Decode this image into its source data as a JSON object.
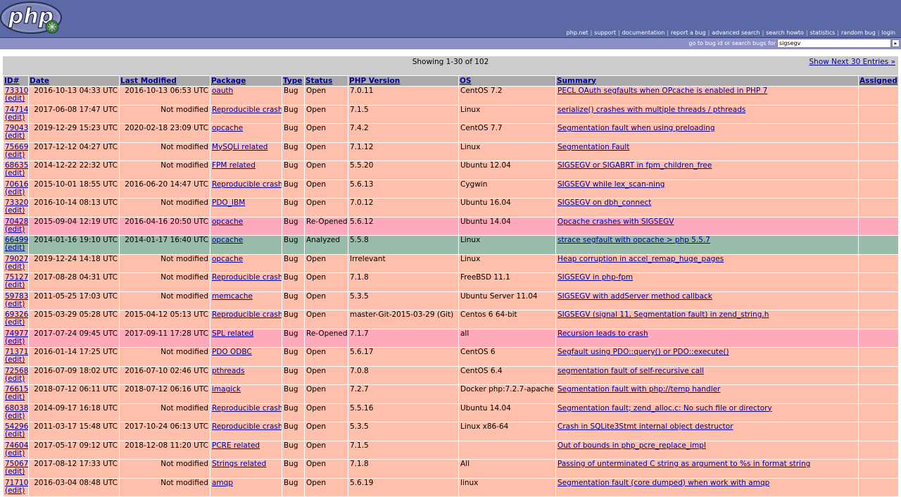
{
  "header": {
    "logo_text": "php",
    "links": [
      "php.net",
      "support",
      "documentation",
      "report a bug",
      "advanced search",
      "search howto",
      "statistics",
      "random bug",
      "login"
    ]
  },
  "search": {
    "label": "go to bug id or search bugs for",
    "value": "sigsegv",
    "go_label": "▸"
  },
  "results": {
    "showing": "Showing 1-30 of 102",
    "next": "Show Next 30 Entries »"
  },
  "table": {
    "columns": [
      "ID#",
      "Date",
      "Last Modified",
      "Package",
      "Type",
      "Status",
      "PHP Version",
      "OS",
      "Summary",
      "Assigned"
    ],
    "edit_label": "(edit)",
    "rows": [
      {
        "id": "73310",
        "date": "2016-10-13 04:33 UTC",
        "mod": "2016-10-13 06:53 UTC",
        "pkg": "oauth",
        "type": "Bug",
        "status": "Open",
        "ver": "7.0.11",
        "os": "CentOS 7.2",
        "summary": "PECL OAuth segfaults when OPcache is enabled in PHP 7",
        "assigned": "",
        "cls": "open"
      },
      {
        "id": "74714",
        "date": "2017-06-08 17:47 UTC",
        "mod": "Not modified",
        "pkg": "Reproducible crash",
        "type": "Bug",
        "status": "Open",
        "ver": "7.1.5",
        "os": "Linux",
        "summary": "serialize() crashes with multiple threads / pthreads",
        "assigned": "",
        "cls": "open"
      },
      {
        "id": "79043",
        "date": "2019-12-29 15:23 UTC",
        "mod": "2020-02-18 23:09 UTC",
        "pkg": "opcache",
        "type": "Bug",
        "status": "Open",
        "ver": "7.4.2",
        "os": "CentOS 7.7",
        "summary": "Segmentation fault when using preloading",
        "assigned": "",
        "cls": "open"
      },
      {
        "id": "75669",
        "date": "2017-12-12 04:27 UTC",
        "mod": "Not modified",
        "pkg": "MySQLi related",
        "type": "Bug",
        "status": "Open",
        "ver": "7.1.12",
        "os": "Linux",
        "summary": "Segmentation Fault",
        "assigned": "",
        "cls": "open"
      },
      {
        "id": "68635",
        "date": "2014-12-22 22:32 UTC",
        "mod": "Not modified",
        "pkg": "FPM related",
        "type": "Bug",
        "status": "Open",
        "ver": "5.5.20",
        "os": "Ubuntu 12.04",
        "summary": "SIGSEGV or SIGABRT in fpm_children_free",
        "assigned": "",
        "cls": "open"
      },
      {
        "id": "70616",
        "date": "2015-10-01 18:55 UTC",
        "mod": "2016-06-20 14:47 UTC",
        "pkg": "Reproducible crash",
        "type": "Bug",
        "status": "Open",
        "ver": "5.6.13",
        "os": "Cygwin",
        "summary": "SIGSEGV while lex_scan-ning",
        "assigned": "",
        "cls": "open"
      },
      {
        "id": "73320",
        "date": "2016-10-14 08:13 UTC",
        "mod": "Not modified",
        "pkg": "PDO_IBM",
        "type": "Bug",
        "status": "Open",
        "ver": "7.0.12",
        "os": "Ubuntu 16.04",
        "summary": "SIGSEGV on dbh_connect",
        "assigned": "",
        "cls": "open"
      },
      {
        "id": "70428",
        "date": "2015-09-04 12:19 UTC",
        "mod": "2016-04-16 20:50 UTC",
        "pkg": "opcache",
        "type": "Bug",
        "status": "Re-Opened",
        "ver": "5.6.12",
        "os": "Ubuntu 14.04",
        "summary": "Opcache crashes with SIGSEGV",
        "assigned": "",
        "cls": "reopened"
      },
      {
        "id": "66499",
        "date": "2014-01-16 19:10 UTC",
        "mod": "2014-01-17 16:40 UTC",
        "pkg": "opcache",
        "type": "Bug",
        "status": "Analyzed",
        "ver": "5.5.8",
        "os": "Linux",
        "summary": "strace segfault with opcache > php 5.5.7",
        "assigned": "",
        "cls": "analyzed"
      },
      {
        "id": "79027",
        "date": "2019-12-24 14:18 UTC",
        "mod": "Not modified",
        "pkg": "opcache",
        "type": "Bug",
        "status": "Open",
        "ver": "Irrelevant",
        "os": "Linux",
        "summary": "Heap corruption in accel_remap_huge_pages",
        "assigned": "",
        "cls": "open"
      },
      {
        "id": "75127",
        "date": "2017-08-28 04:31 UTC",
        "mod": "Not modified",
        "pkg": "Reproducible crash",
        "type": "Bug",
        "status": "Open",
        "ver": "7.1.8",
        "os": "FreeBSD 11.1",
        "summary": "SIGSEGV in php-fpm",
        "assigned": "",
        "cls": "open"
      },
      {
        "id": "59783",
        "date": "2011-05-25 17:03 UTC",
        "mod": "Not modified",
        "pkg": "memcache",
        "type": "Bug",
        "status": "Open",
        "ver": "5.3.5",
        "os": "Ubuntu Server 11.04",
        "summary": "SIGSEGV with addServer method callback",
        "assigned": "",
        "cls": "open"
      },
      {
        "id": "69326",
        "date": "2015-03-29 05:28 UTC",
        "mod": "2015-04-12 05:13 UTC",
        "pkg": "Reproducible crash",
        "type": "Bug",
        "status": "Open",
        "ver": "master-Git-2015-03-29 (Git)",
        "os": "Centos 6 64-bit",
        "summary": "SIGSEGV (signal 11, Segmentation fault) in zend_string.h",
        "assigned": "",
        "cls": "open"
      },
      {
        "id": "74977",
        "date": "2017-07-24 09:45 UTC",
        "mod": "2017-09-11 17:28 UTC",
        "pkg": "SPL related",
        "type": "Bug",
        "status": "Re-Opened",
        "ver": "7.1.7",
        "os": "all",
        "summary": "Recursion leads to crash",
        "assigned": "",
        "cls": "reopened"
      },
      {
        "id": "71371",
        "date": "2016-01-14 17:25 UTC",
        "mod": "Not modified",
        "pkg": "PDO ODBC",
        "type": "Bug",
        "status": "Open",
        "ver": "5.6.17",
        "os": "CentOS 6",
        "summary": "Segfault using PDO::query() or PDO::execute()",
        "assigned": "",
        "cls": "open"
      },
      {
        "id": "72568",
        "date": "2016-07-09 18:02 UTC",
        "mod": "2016-07-10 02:46 UTC",
        "pkg": "pthreads",
        "type": "Bug",
        "status": "Open",
        "ver": "7.0.8",
        "os": "CentOS 6.4",
        "summary": "segmentation fault of self-recursive call",
        "assigned": "",
        "cls": "open"
      },
      {
        "id": "76615",
        "date": "2018-07-12 06:11 UTC",
        "mod": "2018-07-12 06:16 UTC",
        "pkg": "imagick",
        "type": "Bug",
        "status": "Open",
        "ver": "7.2.7",
        "os": "Docker php:7.2.7-apache",
        "summary": "Segmentation fault with php://temp handler",
        "assigned": "",
        "cls": "open"
      },
      {
        "id": "68038",
        "date": "2014-09-17 16:18 UTC",
        "mod": "Not modified",
        "pkg": "Reproducible crash",
        "type": "Bug",
        "status": "Open",
        "ver": "5.5.16",
        "os": "Ubuntu 14.04",
        "summary": "Segmentation fault; zend_alloc.c: No such file or directory",
        "assigned": "",
        "cls": "open"
      },
      {
        "id": "54296",
        "date": "2011-03-17 15:48 UTC",
        "mod": "2017-10-24 06:13 UTC",
        "pkg": "Reproducible crash",
        "type": "Bug",
        "status": "Open",
        "ver": "5.3.5",
        "os": "Linux x86-64",
        "summary": "Crash in SQLite3Stmt internal object destructor",
        "assigned": "",
        "cls": "open"
      },
      {
        "id": "74604",
        "date": "2017-05-17 09:12 UTC",
        "mod": "2018-12-08 11:20 UTC",
        "pkg": "PCRE related",
        "type": "Bug",
        "status": "Open",
        "ver": "7.1.5",
        "os": "",
        "summary": "Out of bounds in php_pcre_replace_impl",
        "assigned": "",
        "cls": "open"
      },
      {
        "id": "75067",
        "date": "2017-08-12 17:33 UTC",
        "mod": "Not modified",
        "pkg": "Strings related",
        "type": "Bug",
        "status": "Open",
        "ver": "7.1.8",
        "os": "All",
        "summary": "Passing of unterminated C string as argument to %s in format string",
        "assigned": "",
        "cls": "open"
      },
      {
        "id": "71710",
        "date": "2016-03-04 08:48 UTC",
        "mod": "Not modified",
        "pkg": "amqp",
        "type": "Bug",
        "status": "Open",
        "ver": "5.6.19",
        "os": "linux",
        "summary": "Segmentation fault (core dumped) when work with amqp",
        "assigned": "",
        "cls": "open"
      }
    ]
  }
}
